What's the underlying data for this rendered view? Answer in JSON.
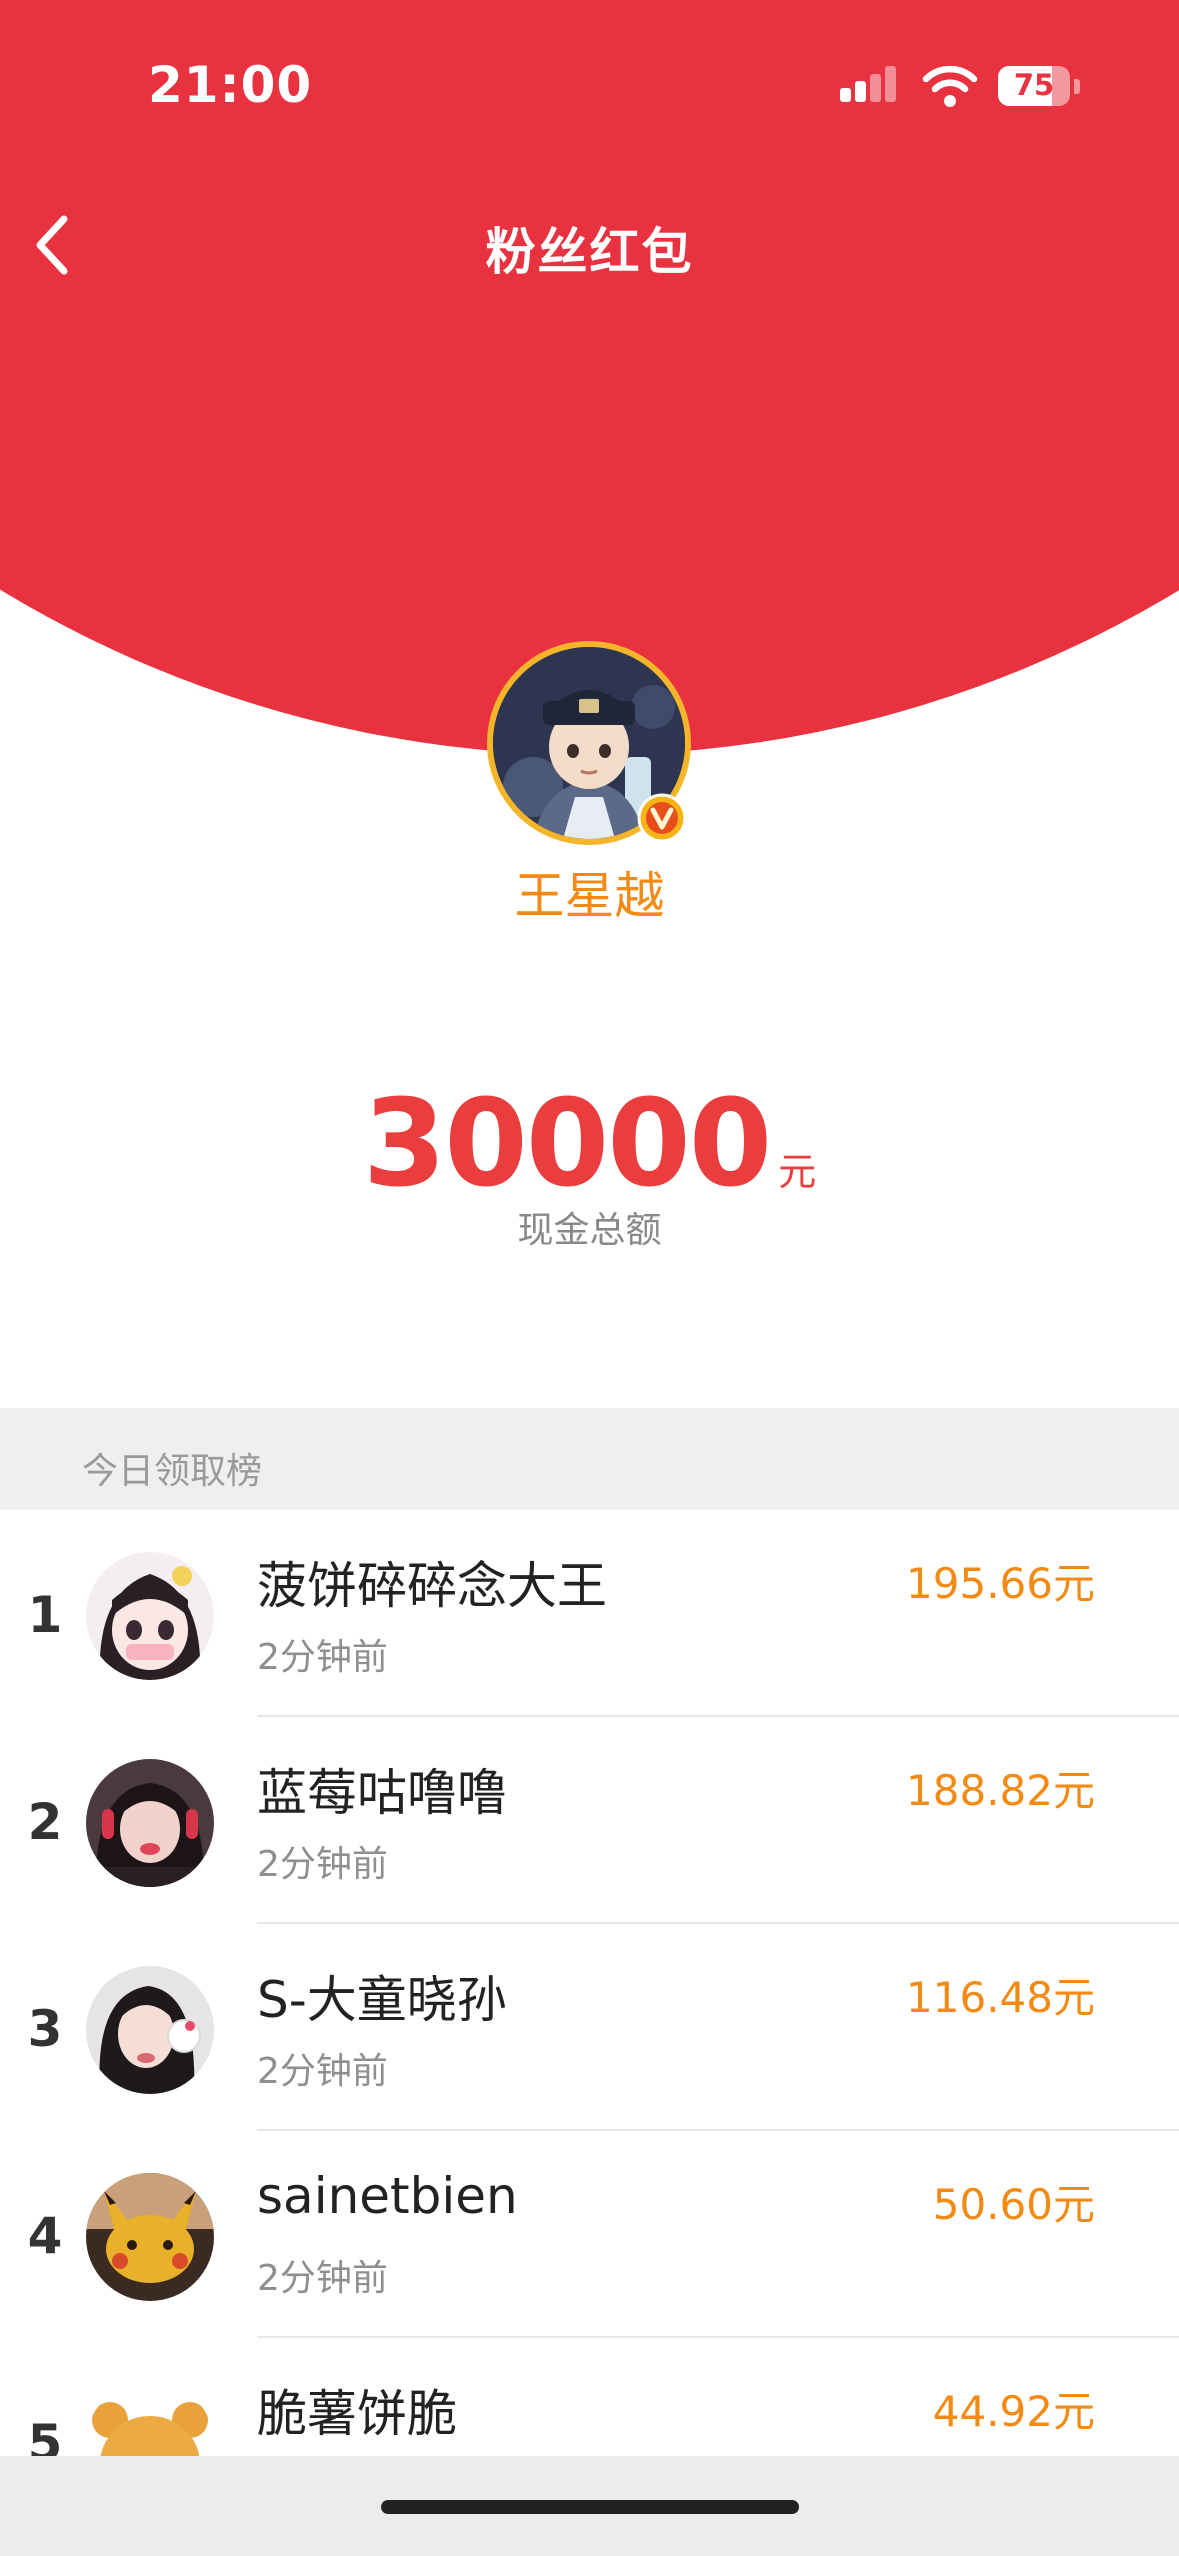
{
  "status_bar": {
    "time": "21:00",
    "battery_level": "75",
    "battery_fraction": 0.75,
    "icons": [
      "signal-icon",
      "wifi-icon",
      "battery-icon"
    ]
  },
  "nav": {
    "title": "粉丝红包",
    "back_icon": "chevron-left-icon"
  },
  "host": {
    "name": "王星越",
    "badge_icon": "verified-v-icon"
  },
  "total": {
    "amount": "30000",
    "unit": "元",
    "label": "现金总额"
  },
  "ranking": {
    "title": "今日领取榜",
    "rows": [
      {
        "rank": "1",
        "name": "菠饼碎碎念大王",
        "time": "2分钟前",
        "amount": "195.66元"
      },
      {
        "rank": "2",
        "name": "蓝莓咕噜噜",
        "time": "2分钟前",
        "amount": "188.82元"
      },
      {
        "rank": "3",
        "name": "S-大童晓孙",
        "time": "2分钟前",
        "amount": "116.48元"
      },
      {
        "rank": "4",
        "name": "sainetbien",
        "time": "2分钟前",
        "amount": "50.60元"
      },
      {
        "rank": "5",
        "name": "脆薯饼脆",
        "time": "",
        "amount": "44.92元"
      }
    ]
  },
  "colors": {
    "header_red": "#e93240",
    "accent_orange": "#f28a14",
    "amount_red": "#ea3d3d",
    "avatar_ring": "#f5b52a"
  }
}
